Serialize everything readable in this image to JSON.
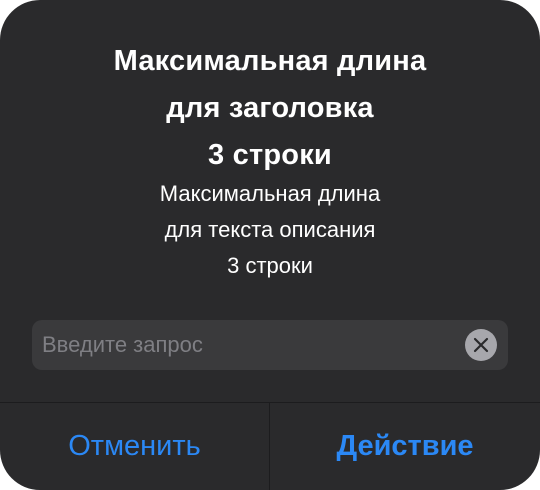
{
  "alert": {
    "title": "Максимальная длина\nдля заголовка\n3 строки",
    "message": "Максимальная длина\nдля текста описания\n3 строки",
    "input": {
      "value": "",
      "placeholder": "Введите запрос",
      "clear_icon": "clear-circle-x-icon"
    },
    "buttons": {
      "cancel_label": "Отменить",
      "action_label": "Действие"
    }
  },
  "colors": {
    "background": "#2a2a2c",
    "field_background": "#3a3a3c",
    "accent": "#2b88f5",
    "placeholder": "#7f7f84",
    "separator": "#1c1c1e"
  }
}
